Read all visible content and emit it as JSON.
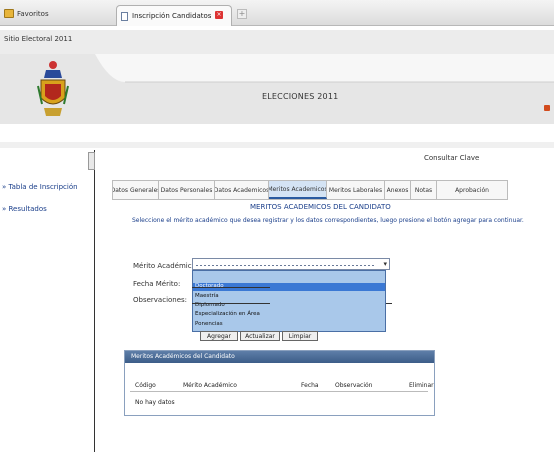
{
  "browser": {
    "favorites_label": "Favoritos",
    "tab_title": "Inscripción Candidatos",
    "new_tab_symbol": "+",
    "close_symbol": "×"
  },
  "app": {
    "tab_label": "Sitio Electoral 2011",
    "header_title": "ELECCIONES 2011",
    "consult_link": "Consultar Clave"
  },
  "sidebar": {
    "items": [
      {
        "label": "» Tabla de Inscripción"
      },
      {
        "label": "» Resultados"
      }
    ]
  },
  "content": {
    "tabs": [
      {
        "label": "Datos Generales",
        "active": false
      },
      {
        "label": "Datos Personales",
        "active": false
      },
      {
        "label": "Datos Academicos",
        "active": false
      },
      {
        "label": "Meritos Academicos",
        "active": true
      },
      {
        "label": "Meritos Laborales",
        "active": false
      },
      {
        "label": "Anexos",
        "active": false
      },
      {
        "label": "Notas",
        "active": false
      },
      {
        "label": "Aprobación",
        "active": false
      }
    ],
    "title": "MERITOS ACADEMICOS DEL CANDIDATO",
    "note": "Seleccione el mérito académico que desea registrar y los datos correspondientes, luego presione el botón agregar para continuar."
  },
  "form": {
    "merit_label": "Mérito Académico:",
    "date_label": "Fecha Mérito:",
    "obs_label": "Observaciones:",
    "dropdown_options": [
      {
        "label": "",
        "selected": false
      },
      {
        "label": "Doctorado",
        "selected": true
      },
      {
        "label": "Maestría",
        "selected": false
      },
      {
        "label": "Diplomado",
        "selected": false
      },
      {
        "label": "Especialización en Área",
        "selected": false
      },
      {
        "label": "Ponencias",
        "selected": false
      }
    ],
    "buttons": {
      "add": "Agregar",
      "update": "Actualizar",
      "clear": "Limpiar"
    }
  },
  "results": {
    "panel_title": "Meritos Académicos del Candidato",
    "columns": [
      "Código",
      "Mérito Académico",
      "Fecha",
      "Observación",
      "Eliminar"
    ],
    "empty_message": "No hay datos"
  },
  "colors": {
    "accent": "#3c5d88",
    "link": "#1a3e8a",
    "dropdown_bg": "#a9c8ea",
    "dropdown_selected": "#3a78d4"
  }
}
